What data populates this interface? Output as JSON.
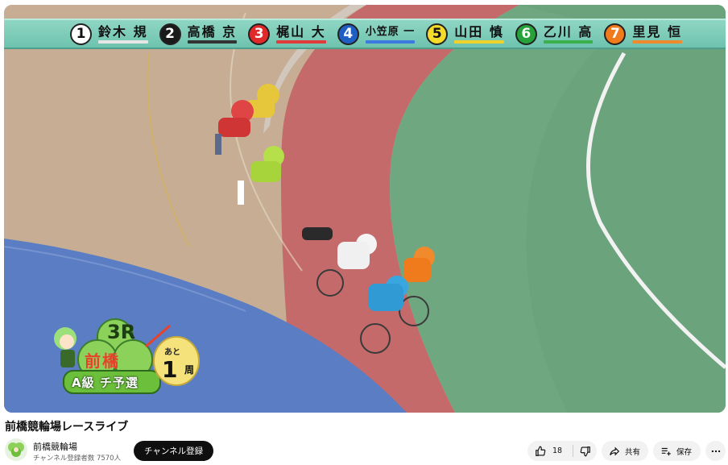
{
  "riders": [
    {
      "number": "1",
      "name": "鈴木 規",
      "bg": "#ffffff",
      "fg": "#111111",
      "underline": "#e6e6e6"
    },
    {
      "number": "2",
      "name": "高橋 京",
      "bg": "#1a1a1a",
      "fg": "#ffffff",
      "underline": "#333333"
    },
    {
      "number": "3",
      "name": "梶山 大",
      "bg": "#e02a2a",
      "fg": "#ffffff",
      "underline": "#e23b3b"
    },
    {
      "number": "4",
      "name": "小笠原 一",
      "bg": "#1f5fc4",
      "fg": "#ffffff",
      "underline": "#3b7be0"
    },
    {
      "number": "5",
      "name": "山田 慎",
      "bg": "#f5dc2a",
      "fg": "#111111",
      "underline": "#f0d22a"
    },
    {
      "number": "6",
      "name": "乙川 高",
      "bg": "#27a23a",
      "fg": "#ffffff",
      "underline": "#39b04a"
    },
    {
      "number": "7",
      "name": "里見 恒",
      "bg": "#f07b1c",
      "fg": "#ffffff",
      "underline": "#f08a2c"
    }
  ],
  "race_badge": {
    "race_number": "3R",
    "venue": "前橋",
    "class": "A級 チ予選",
    "laps_prefix": "あと",
    "laps_remaining": "1",
    "laps_unit": "周"
  },
  "video": {
    "title": "前橋競輪場レースライブ"
  },
  "channel": {
    "name": "前橋競輪場",
    "subscribers": "チャンネル登録者数 7570人",
    "subscribe_label": "チャンネル登録"
  },
  "actions": {
    "like_count": "18",
    "share_label": "共有",
    "save_label": "保存"
  },
  "icons": {
    "like": "thumbs-up-icon",
    "dislike": "thumbs-down-icon",
    "share": "share-arrow-icon",
    "save": "playlist-add-icon",
    "more": "more-horizontal-icon"
  }
}
